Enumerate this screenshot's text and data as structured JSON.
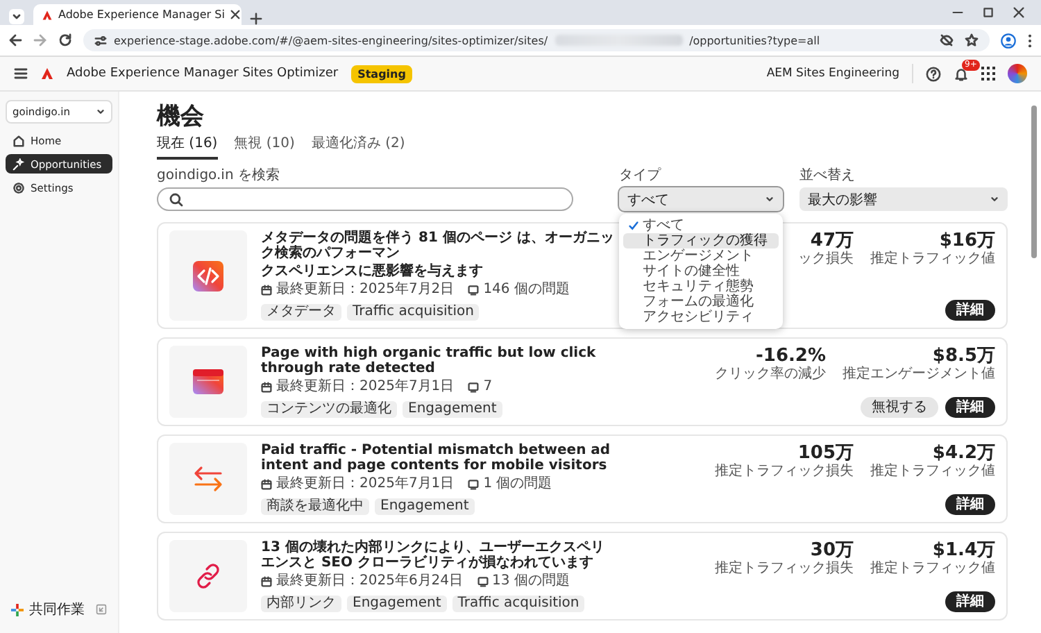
{
  "browser": {
    "tab_title": "Adobe Experience Manager Si",
    "url_start": "experience-stage.adobe.com/#/@aem-sites-engineering/sites-optimizer/sites/",
    "url_end": "/opportunities?type=all"
  },
  "app": {
    "product": "Adobe Experience Manager Sites Optimizer",
    "env_badge": "Staging",
    "org": "AEM Sites Engineering",
    "notification_count": "9+"
  },
  "sidebar": {
    "site": "goindigo.in",
    "items": [
      {
        "kind": "home",
        "label": "Home",
        "selected": false
      },
      {
        "kind": "opportunities",
        "label": "Opportunities",
        "selected": true
      },
      {
        "kind": "settings",
        "label": "Settings",
        "selected": false
      }
    ],
    "footer": "共同作業"
  },
  "page": {
    "title": "機会",
    "tabs": [
      {
        "label": "現在 (16)",
        "selected": true
      },
      {
        "label": "無視 (10)",
        "selected": false
      },
      {
        "label": "最適化済み (2)",
        "selected": false
      }
    ],
    "search_label": "goindigo.in を検索",
    "filters": [
      {
        "label": "タイプ",
        "value": "すべて",
        "expanded": true
      },
      {
        "label": "並べ替え",
        "value": "最大の影響",
        "expanded": false
      }
    ],
    "type_menu": [
      {
        "label": "すべて",
        "selected": true,
        "highlighted": false
      },
      {
        "label": "トラフィックの獲得",
        "selected": false,
        "highlighted": true
      },
      {
        "label": "エンゲージメント",
        "selected": false,
        "highlighted": false
      },
      {
        "label": "サイトの健全性",
        "selected": false,
        "highlighted": false
      },
      {
        "label": "セキュリティ態勢",
        "selected": false,
        "highlighted": false
      },
      {
        "label": "フォームの最適化",
        "selected": false,
        "highlighted": false
      },
      {
        "label": "アクセシビリティ",
        "selected": false,
        "highlighted": false
      }
    ]
  },
  "cards": [
    {
      "kind": "code",
      "title_lines": [
        "メタデータの問題を伴う 81 個のページ は、オーガニック検索のパフォーマン",
        "クスペリエンスに悪影響を与えます"
      ],
      "updated": "最終更新日：2025年7月2日",
      "issues": "146 個の問題",
      "tags": [
        "メタデータ",
        "Traffic acquisition"
      ],
      "metrics": [
        {
          "value": "47万",
          "label": "ック損失"
        },
        {
          "value": "$16万",
          "label": "推定トラフィック値"
        }
      ],
      "actions": [
        {
          "label": "詳細",
          "kind": "primary"
        }
      ]
    },
    {
      "kind": "page",
      "title_lines": [
        "Page with high organic traffic but low click through rate detected"
      ],
      "updated": "最終更新日：2025年7月1日",
      "issues": "7",
      "tags": [
        "コンテンツの最適化",
        "Engagement"
      ],
      "metrics": [
        {
          "value": "-16.2%",
          "label": "クリック率の減少"
        },
        {
          "value": "$8.5万",
          "label": "推定エンゲージメント値"
        }
      ],
      "actions": [
        {
          "label": "無視する",
          "kind": "secondary"
        },
        {
          "label": "詳細",
          "kind": "primary"
        }
      ]
    },
    {
      "kind": "arrows",
      "title_lines": [
        "Paid traffic - Potential mismatch between ad intent and page contents for mobile visitors"
      ],
      "updated": "最終更新日：2025年7月1日",
      "issues": "1 個の問題",
      "tags": [
        "商談を最適化中",
        "Engagement"
      ],
      "metrics": [
        {
          "value": "105万",
          "label": "推定トラフィック損失"
        },
        {
          "value": "$4.2万",
          "label": "推定トラフィック値"
        }
      ],
      "actions": [
        {
          "label": "詳細",
          "kind": "primary"
        }
      ]
    },
    {
      "kind": "link",
      "title_lines": [
        "13 個の壊れた内部リンクにより、ユーザーエクスペリエンスと SEO クローラビリティが損なわれています"
      ],
      "updated": "最終更新日：2025年6月24日",
      "issues": "13 個の問題",
      "tags": [
        "内部リンク",
        "Engagement",
        "Traffic acquisition"
      ],
      "metrics": [
        {
          "value": "30万",
          "label": "推定トラフィック損失"
        },
        {
          "value": "$1.4万",
          "label": "推定トラフィック値"
        }
      ],
      "actions": [
        {
          "label": "詳細",
          "kind": "primary"
        }
      ]
    }
  ]
}
